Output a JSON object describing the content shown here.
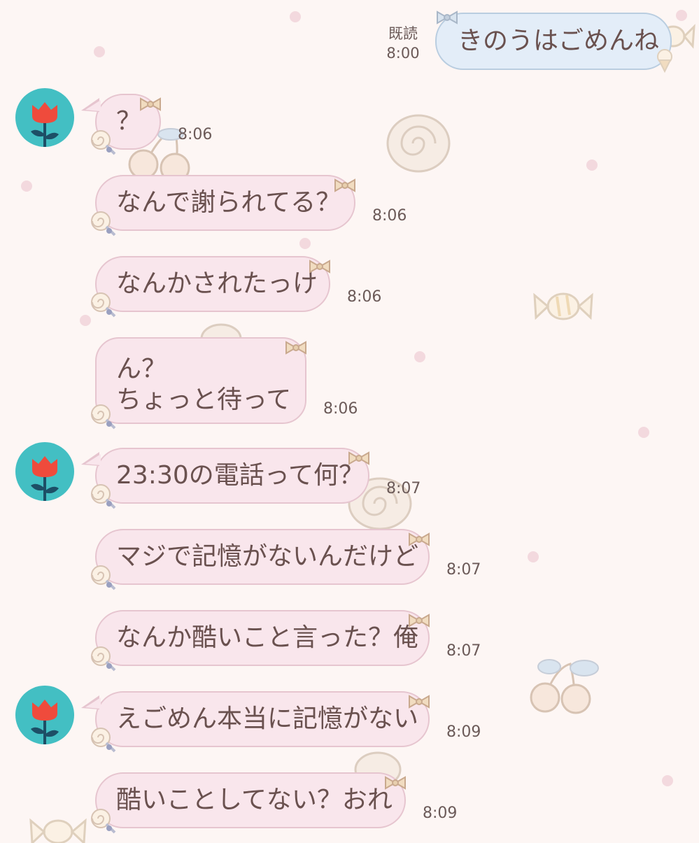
{
  "colors": {
    "background": "#fdf6f4",
    "friend_bubble": "#f9e6ec",
    "my_bubble": "#e3edf8",
    "avatar_bg": "#43bfc3",
    "avatar_flower": "#ef4b3c"
  },
  "sent": {
    "text": "きのうはごめんね",
    "read_label": "既読",
    "time": "8:00"
  },
  "messages": [
    {
      "text": "？",
      "time": "8:06"
    },
    {
      "text": "なんで謝られてる？",
      "time": "8:06"
    },
    {
      "text": "なんかされたっけ",
      "time": "8:06"
    },
    {
      "text": "ん？\nちょっと待って",
      "time": "8:06"
    },
    {
      "text": "23:30の電話って何？",
      "time": "8:07"
    },
    {
      "text": "マジで記憶がないんだけど",
      "time": "8:07"
    },
    {
      "text": "なんか酷いこと言った？俺",
      "time": "8:07"
    },
    {
      "text": "えごめん本当に記憶がない",
      "time": "8:09"
    },
    {
      "text": "酷いことしてない？おれ",
      "time": "8:09"
    }
  ],
  "icons": {
    "avatar": "tulip-icon",
    "bubble_decoration": "bow-icon",
    "bubble_sticker": "lollipop-icon"
  }
}
